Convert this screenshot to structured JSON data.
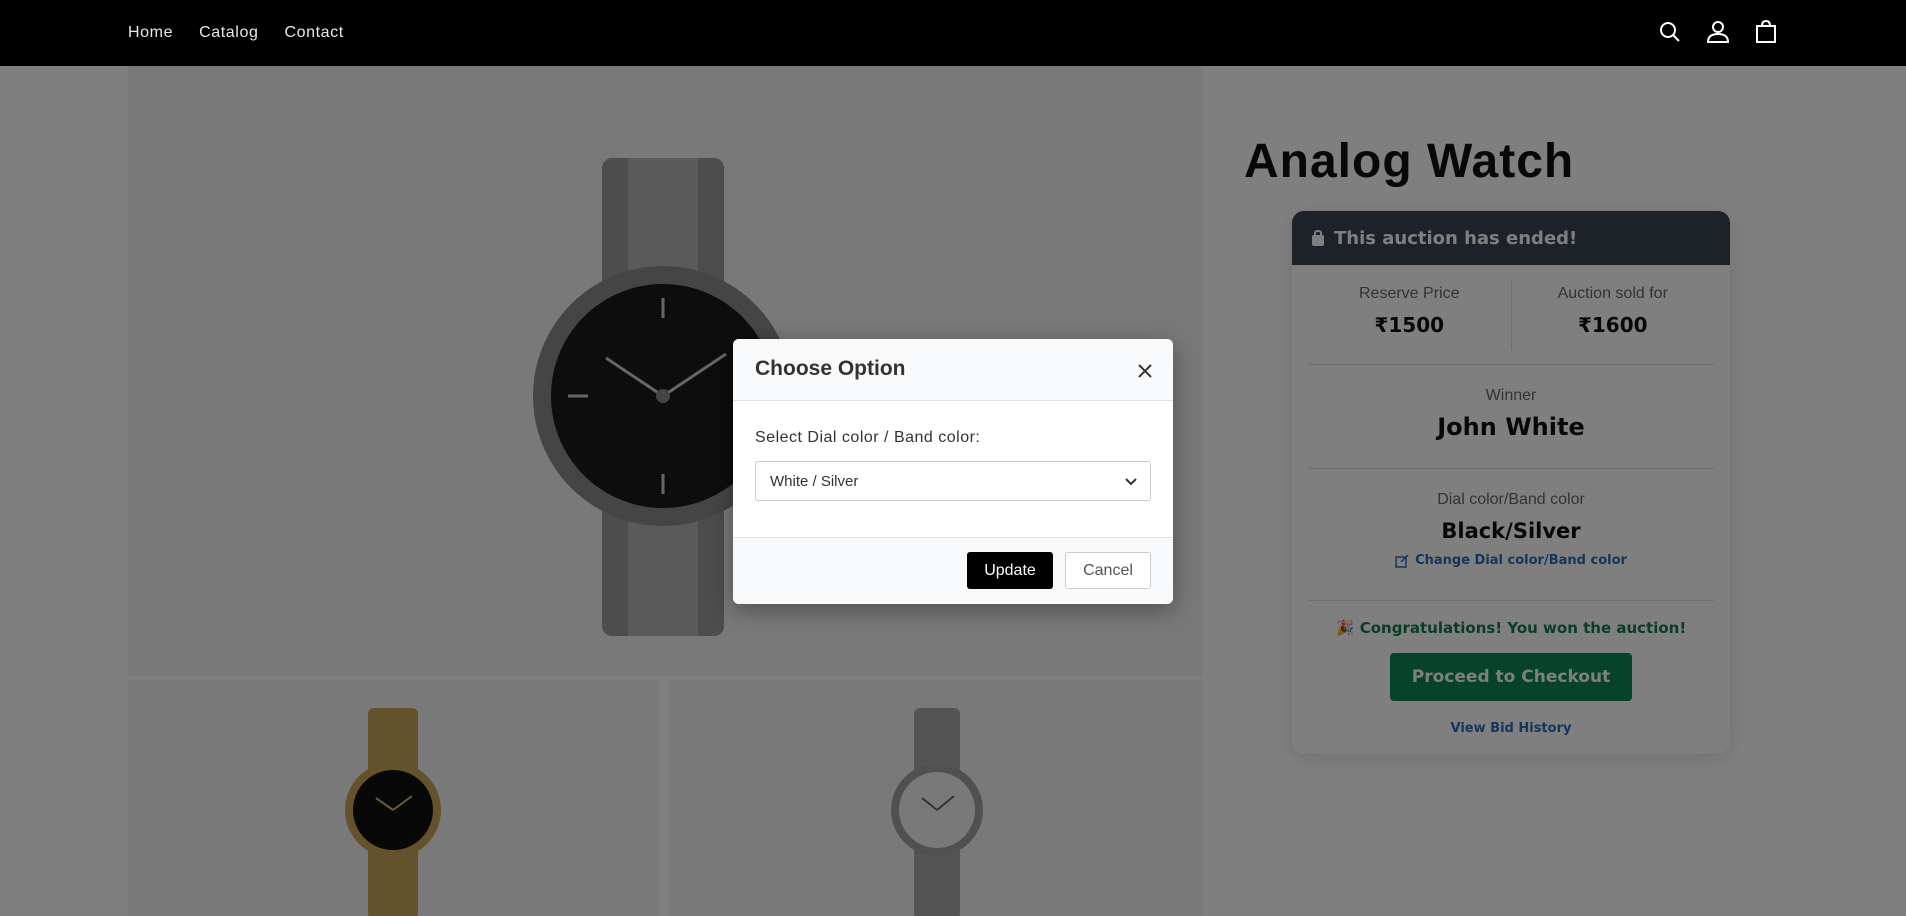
{
  "nav": {
    "items": [
      "Home",
      "Catalog",
      "Contact"
    ]
  },
  "header_icons": [
    "search-icon",
    "account-icon",
    "cart-icon"
  ],
  "product": {
    "title": "Analog Watch",
    "images": {
      "main": "silver-watch-black-dial",
      "thumbs": [
        "gold-watch-black-dial",
        "silver-watch-white-dial"
      ]
    }
  },
  "auction": {
    "status": "This auction has ended!",
    "reserve_label": "Reserve Price",
    "reserve_value": "₹1500",
    "sold_label": "Auction sold for",
    "sold_value": "₹1600",
    "winner_label": "Winner",
    "winner_value": "John White",
    "option_label": "Dial color/Band color",
    "option_value": "Black/Silver",
    "change_link": "Change Dial color/Band color",
    "congrats": "Congratulations! You won the auction!",
    "checkout_label": "Proceed to Checkout",
    "history_link": "View Bid History"
  },
  "modal": {
    "title": "Choose Option",
    "select_label": "Select Dial color / Band color:",
    "selected_value": "White / Silver",
    "update_label": "Update",
    "cancel_label": "Cancel"
  },
  "colors": {
    "header_bg": "#000000",
    "card_head_bg": "#3a4450",
    "checkout_bg": "#0e8556",
    "link": "#2a6bb8",
    "congrats": "#127a4a"
  }
}
